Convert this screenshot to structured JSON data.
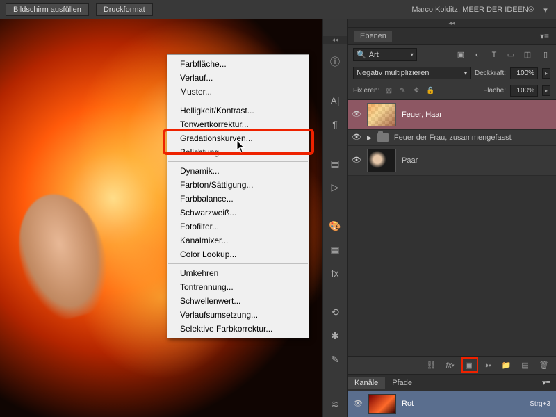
{
  "topbar": {
    "fill_screen": "Bildschirm ausfüllen",
    "print_format": "Druckformat",
    "credit": "Marco Kolditz, MEER DER IDEEN®"
  },
  "context_menu": {
    "groups": [
      [
        "Farbfläche...",
        "Verlauf...",
        "Muster..."
      ],
      [
        "Helligkeit/Kontrast...",
        "Tonwertkorrektur...",
        "Gradationskurven...",
        "Belichtung..."
      ],
      [
        "Dynamik...",
        "Farbton/Sättigung...",
        "Farbbalance...",
        "Schwarzweiß...",
        "Fotofilter...",
        "Kanalmixer...",
        "Color Lookup..."
      ],
      [
        "Umkehren",
        "Tontrennung...",
        "Schwellenwert...",
        "Verlaufsumsetzung...",
        "Selektive Farbkorrektur..."
      ]
    ],
    "highlighted": "Tonwertkorrektur..."
  },
  "layers_panel": {
    "tab": "Ebenen",
    "search_label": "Art",
    "blend_mode": "Negativ multiplizieren",
    "opacity_label": "Deckkraft:",
    "opacity_value": "100%",
    "lock_label": "Fixieren:",
    "fill_label": "Fläche:",
    "fill_value": "100%",
    "layers": [
      {
        "name": "Feuer, Haar",
        "selected": true,
        "kind": "fire"
      },
      {
        "name": "Feuer der Frau, zusammengefasst",
        "selected": false,
        "kind": "group"
      },
      {
        "name": "Paar",
        "selected": false,
        "kind": "pair"
      }
    ]
  },
  "channels_panel": {
    "tabs": [
      "Kanäle",
      "Pfade"
    ],
    "channel": {
      "name": "Rot",
      "shortcut": "Strg+3"
    }
  }
}
